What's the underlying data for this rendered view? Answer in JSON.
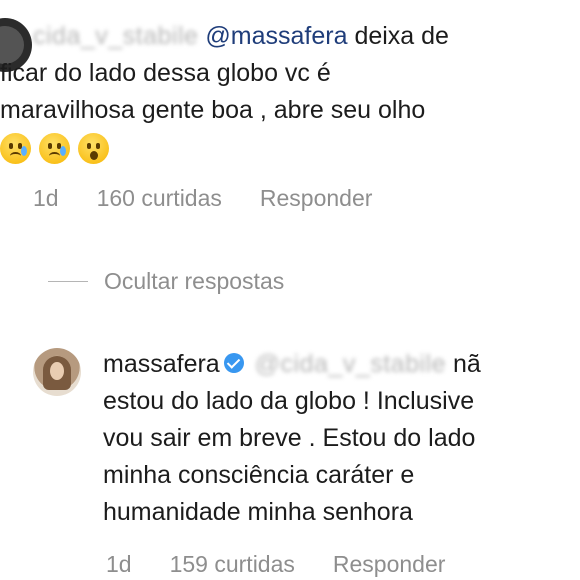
{
  "comment": {
    "username": "cida_v_stabile",
    "mention": "@massafera",
    "lines": [
      "deixa de",
      "ficar do lado dessa globo vc é",
      "maravilhosa gente boa , abre seu olho"
    ],
    "emojis": [
      "crying-face",
      "crying-face",
      "surprised-face"
    ],
    "time": "1d",
    "likes": "160 curtidas",
    "reply_label": "Responder"
  },
  "toggle_replies": "Ocultar respostas",
  "reply": {
    "username": "massafera",
    "mention": "@cida_v_stabile",
    "lines": [
      "nã",
      "estou do lado da globo ! Inclusive",
      "vou sair em breve . Estou do lado",
      "minha consciência caráter e",
      "humanidade minha senhora"
    ],
    "time": "1d",
    "likes": "159 curtidas",
    "reply_label": "Responder"
  }
}
